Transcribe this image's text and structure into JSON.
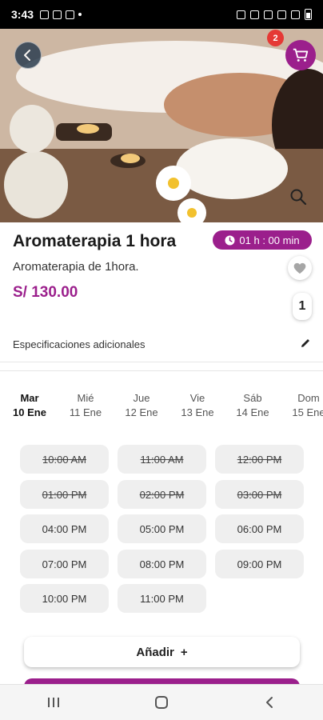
{
  "status_bar": {
    "time": "3:43"
  },
  "cart": {
    "badge_count": "2"
  },
  "product": {
    "title": "Aromaterapia 1 hora",
    "duration": "01 h : 00 min",
    "description": "Aromaterapia de 1hora.",
    "price": "S/ 130.00",
    "quantity": "1",
    "specs_label": "Especificaciones adicionales"
  },
  "days": [
    {
      "name": "Mar",
      "date": "10 Ene",
      "active": true
    },
    {
      "name": "Mié",
      "date": "11 Ene",
      "active": false
    },
    {
      "name": "Jue",
      "date": "12 Ene",
      "active": false
    },
    {
      "name": "Vie",
      "date": "13 Ene",
      "active": false
    },
    {
      "name": "Sáb",
      "date": "14 Ene",
      "active": false
    },
    {
      "name": "Dom",
      "date": "15 Ene",
      "active": false
    }
  ],
  "slots": [
    {
      "time": "10:00 AM",
      "available": false
    },
    {
      "time": "11:00 AM",
      "available": false
    },
    {
      "time": "12:00 PM",
      "available": false
    },
    {
      "time": "01:00 PM",
      "available": false
    },
    {
      "time": "02:00 PM",
      "available": false
    },
    {
      "time": "03:00 PM",
      "available": false
    },
    {
      "time": "04:00 PM",
      "available": true
    },
    {
      "time": "05:00 PM",
      "available": true
    },
    {
      "time": "06:00 PM",
      "available": true
    },
    {
      "time": "07:00 PM",
      "available": true
    },
    {
      "time": "08:00 PM",
      "available": true
    },
    {
      "time": "09:00 PM",
      "available": true
    },
    {
      "time": "10:00 PM",
      "available": true
    },
    {
      "time": "11:00 PM",
      "available": true
    }
  ],
  "actions": {
    "add_label": "Añadir",
    "add_symbol": "+"
  },
  "colors": {
    "brand": "#9b1f8c",
    "badge": "#e53935"
  },
  "icons": [
    "back-arrow-icon",
    "cart-icon",
    "zoom-icon",
    "clock-icon",
    "heart-icon",
    "pencil-icon",
    "plus-icon",
    "recent-apps-icon",
    "home-icon",
    "back-icon"
  ]
}
